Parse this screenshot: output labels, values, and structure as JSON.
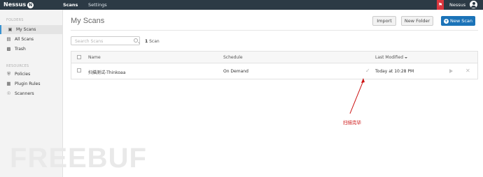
{
  "app": {
    "logo": "Nessus",
    "logo_badge": "N",
    "nav": [
      {
        "label": "Scans",
        "active": true
      },
      {
        "label": "Settings",
        "active": false
      }
    ],
    "user_name": "Nessus",
    "colors": {
      "topbar": "#2c3a45",
      "accent": "#1b73b8",
      "alert": "#d9363e",
      "annotation": "#cc1111"
    }
  },
  "sidebar": {
    "folders_heading": "FOLDERS",
    "folders": [
      {
        "label": "My Scans",
        "icon": "folder-open-icon",
        "active": true
      },
      {
        "label": "All Scans",
        "icon": "folders-icon",
        "active": false
      },
      {
        "label": "Trash",
        "icon": "trash-icon",
        "active": false
      }
    ],
    "resources_heading": "RESOURCES",
    "resources": [
      {
        "label": "Policies",
        "icon": "shield-icon"
      },
      {
        "label": "Plugin Rules",
        "icon": "plugin-icon"
      },
      {
        "label": "Scanners",
        "icon": "scanner-icon"
      }
    ]
  },
  "main": {
    "title": "My Scans",
    "buttons": {
      "import": "Import",
      "new_folder": "New Folder",
      "new_scan": "New Scan"
    },
    "search_placeholder": "Search Scans",
    "scan_count_number": "1",
    "scan_count_label": "Scan",
    "table": {
      "columns": [
        "Name",
        "Schedule",
        "Last Modified"
      ],
      "sort_column": "Last Modified",
      "rows": [
        {
          "name": "扫描测试-Thinkoaa",
          "schedule": "On Demand",
          "status_icon": "check-icon",
          "last_modified": "Today at 10:28 PM"
        }
      ]
    }
  },
  "annotation": {
    "text": "扫描完毕"
  },
  "watermark": "FREEBUF"
}
